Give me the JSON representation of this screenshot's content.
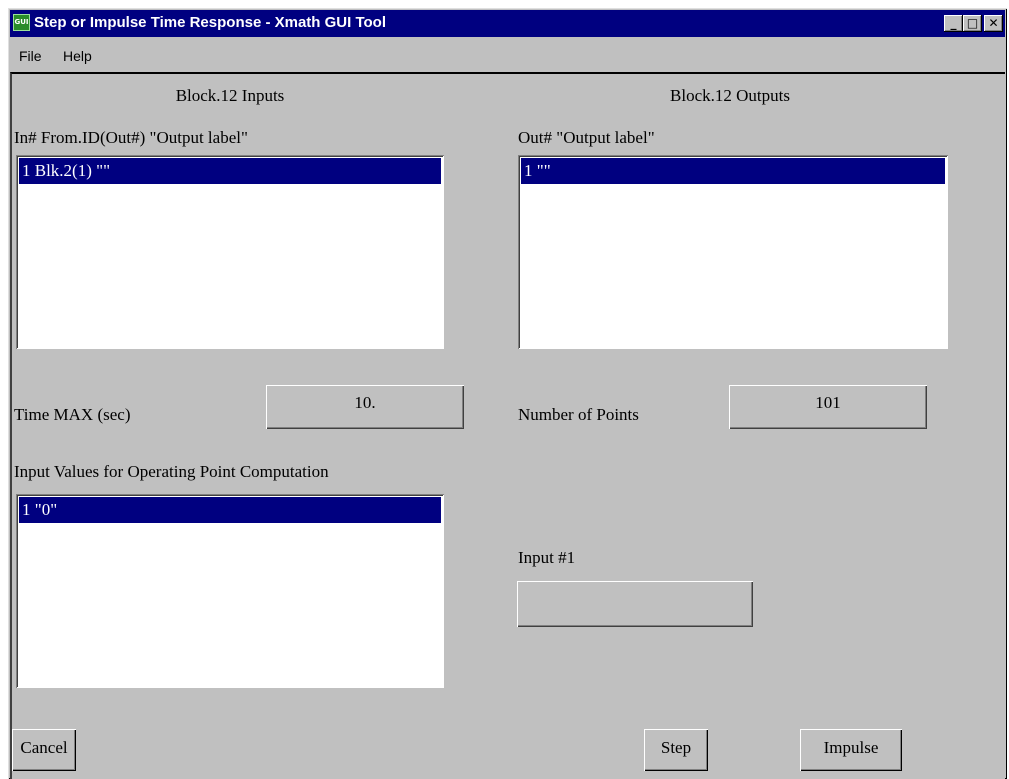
{
  "window": {
    "title": "Step or Impulse Time Response - Xmath GUI Tool",
    "icon_text": "GUI",
    "controls": {
      "minimize": "_",
      "maximize": "□",
      "close": "✕"
    }
  },
  "menu": {
    "file": "File",
    "help": "Help"
  },
  "inputs": {
    "section_title": "Block.12 Inputs",
    "list_header": "In# From.ID(Out#) \"Output label\"",
    "items": [
      "1 Blk.2(1) \"\""
    ]
  },
  "outputs": {
    "section_title": "Block.12 Outputs",
    "list_header": "Out# \"Output label\"",
    "items": [
      "1 \"\""
    ]
  },
  "time_max": {
    "label": "Time MAX (sec)",
    "value": "10."
  },
  "num_points": {
    "label": "Number of Points",
    "value": "101"
  },
  "operating_point": {
    "label": "Input Values for Operating Point Computation",
    "items": [
      "1 \"0\""
    ]
  },
  "input_field": {
    "label": "Input #1",
    "value": ""
  },
  "buttons": {
    "cancel": "Cancel",
    "step": "Step",
    "impulse": "Impulse"
  }
}
